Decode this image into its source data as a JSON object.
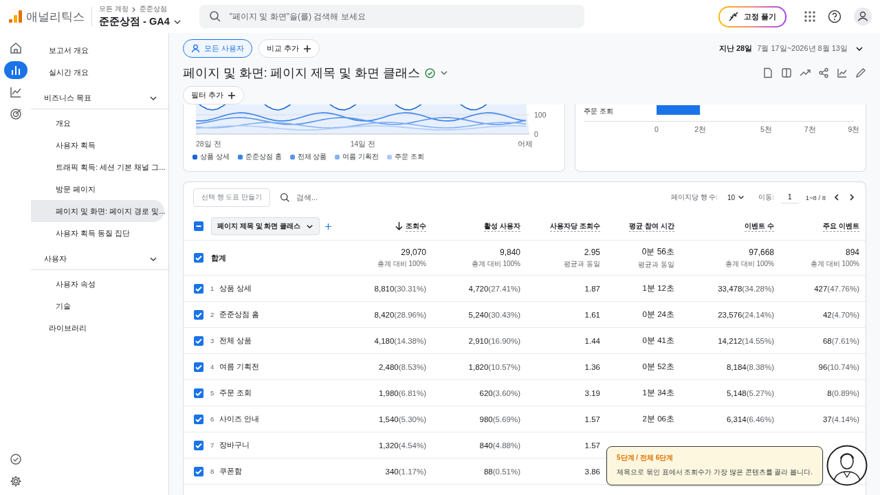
{
  "header": {
    "product": "애널리틱스",
    "breadcrumb": [
      "모든 계정",
      "준준상점"
    ],
    "property": "준준상점 - GA4",
    "search_placeholder": "\"페이지 및 화면\"을(를) 검색해 보세요",
    "unpin_button": "고정 풀기"
  },
  "rail": [
    {
      "kind": "home",
      "selected": false
    },
    {
      "kind": "bar-chart",
      "selected": true
    },
    {
      "kind": "line-chart",
      "selected": false
    },
    {
      "kind": "target",
      "selected": false
    }
  ],
  "rail_bottom": [
    {
      "kind": "check-circle"
    },
    {
      "kind": "gear"
    }
  ],
  "nav": [
    {
      "kind": "item",
      "label": "보고서 개요",
      "selected": false
    },
    {
      "kind": "item",
      "label": "실시간 개요",
      "selected": false
    },
    {
      "kind": "section",
      "label": "비즈니스 목표",
      "expanded": true,
      "children": [
        {
          "label": "개요",
          "selected": false
        },
        {
          "label": "사용자 획득",
          "selected": false
        },
        {
          "label": "트래픽 획득: 세션 기본 채널 그...",
          "selected": false
        },
        {
          "label": "방문 페이지",
          "selected": false
        },
        {
          "label": "페이지 및 화면: 페이지 경로 및...",
          "selected": true
        },
        {
          "label": "사용자 획득 동질 집단",
          "selected": false
        }
      ]
    },
    {
      "kind": "section",
      "label": "사용자",
      "expanded": true,
      "children": [
        {
          "label": "사용자 속성",
          "selected": false
        },
        {
          "label": "기술",
          "selected": false
        }
      ]
    },
    {
      "kind": "item",
      "label": "라이브러리",
      "selected": false
    }
  ],
  "toolbar": {
    "segment": "모든 사용자",
    "compare": "비교 추가",
    "date_label": "지난 28일",
    "date_range": "7월 17일~2026년 8월 13일"
  },
  "report": {
    "title": "페이지 및 화면: 페이지 제목 및 화면 클래스",
    "verified": true,
    "filter_button": "필터 추가"
  },
  "line_chart": {
    "y_tick_labels": [
      "100",
      "0"
    ],
    "x_tick_labels": [
      "28일 전",
      "14일 전",
      "어제"
    ],
    "legend": [
      {
        "name": "상품 상세",
        "color": "#1967d2"
      },
      {
        "name": "준준상점 홈",
        "color": "#3b82e8"
      },
      {
        "name": "전체 상품",
        "color": "#5a95ea"
      },
      {
        "name": "여름 기획전",
        "color": "#86b2f1"
      },
      {
        "name": "주문 조회",
        "color": "#aecbfa"
      }
    ]
  },
  "bar_chart": {
    "chart_data": {
      "type": "bar",
      "orientation": "horizontal",
      "categories": [
        "주문 조회"
      ],
      "series": [
        {
          "color": "#1a73e8",
          "values": [
            1.98
          ]
        }
      ],
      "xlim": [
        0,
        9
      ],
      "xticks": [
        {
          "value": 0,
          "label": "0"
        },
        {
          "value": 2,
          "label": "2천"
        },
        {
          "value": 5,
          "label": "5천"
        },
        {
          "value": 7,
          "label": "7천"
        },
        {
          "value": 9,
          "label": "9천"
        }
      ]
    }
  },
  "table": {
    "plot_button": "선택 행 도표 만들기",
    "search_placeholder": "검색...",
    "rows_per_page_label": "페이지당 행 수:",
    "rows_per_page": "10",
    "goto_label": "이동:",
    "goto_value": "1",
    "range": "1~8 / 8",
    "dimension": "페이지 제목 및 화면 클래스",
    "select_all_indeterminate": true,
    "columns": [
      {
        "label": "조회수",
        "sorted": true
      },
      {
        "label": "활성 사용자",
        "sorted": false
      },
      {
        "label": "사용자당 조회수",
        "sorted": false
      },
      {
        "label": "평균 참여 시간",
        "sorted": false
      },
      {
        "label": "이벤트 수",
        "sorted": false
      },
      {
        "label": "주요 이벤트",
        "sorted": false
      }
    ],
    "total": {
      "label": "합계",
      "checked": true,
      "cells": [
        {
          "value": "29,070",
          "note": "총계 대비 100%"
        },
        {
          "value": "9,840",
          "note": "총계 대비 100%"
        },
        {
          "value": "2.95",
          "note": "평균과 동일"
        },
        {
          "value": "0분 56초",
          "note": "평균과 동일"
        },
        {
          "value": "97,668",
          "note": "총계 대비 100%"
        },
        {
          "value": "894",
          "note": "총계 대비 100%"
        }
      ]
    },
    "rows": [
      {
        "index": "1",
        "name": "상품 상세",
        "checked": true,
        "cells": [
          {
            "value": "8,810",
            "share": "(30.31%)"
          },
          {
            "value": "4,720",
            "share": "(27.41%)"
          },
          {
            "value": "1.87"
          },
          {
            "value": "1분 12초"
          },
          {
            "value": "33,478",
            "share": "(34.28%)"
          },
          {
            "value": "427",
            "share": "(47.76%)"
          }
        ]
      },
      {
        "index": "2",
        "name": "준준상점 홈",
        "checked": true,
        "cells": [
          {
            "value": "8,420",
            "share": "(28.96%)"
          },
          {
            "value": "5,240",
            "share": "(30.43%)"
          },
          {
            "value": "1.61"
          },
          {
            "value": "0분 24초"
          },
          {
            "value": "23,576",
            "share": "(24.14%)"
          },
          {
            "value": "42",
            "share": "(4.70%)"
          }
        ]
      },
      {
        "index": "3",
        "name": "전체 상품",
        "checked": true,
        "cells": [
          {
            "value": "4,180",
            "share": "(14.38%)"
          },
          {
            "value": "2,910",
            "share": "(16.90%)"
          },
          {
            "value": "1.44"
          },
          {
            "value": "0분 41초"
          },
          {
            "value": "14,212",
            "share": "(14.55%)"
          },
          {
            "value": "68",
            "share": "(7.61%)"
          }
        ]
      },
      {
        "index": "4",
        "name": "여름 기획전",
        "checked": true,
        "cells": [
          {
            "value": "2,480",
            "share": "(8.53%)"
          },
          {
            "value": "1,820",
            "share": "(10.57%)"
          },
          {
            "value": "1.36"
          },
          {
            "value": "0분 52초"
          },
          {
            "value": "8,184",
            "share": "(8.38%)"
          },
          {
            "value": "96",
            "share": "(10.74%)"
          }
        ]
      },
      {
        "index": "5",
        "name": "주문 조회",
        "checked": true,
        "cells": [
          {
            "value": "1,980",
            "share": "(6.81%)"
          },
          {
            "value": "620",
            "share": "(3.60%)"
          },
          {
            "value": "3.19"
          },
          {
            "value": "1분 34초"
          },
          {
            "value": "5,148",
            "share": "(5.27%)"
          },
          {
            "value": "8",
            "share": "(0.89%)"
          }
        ]
      },
      {
        "index": "6",
        "name": "사이즈 안내",
        "checked": true,
        "cells": [
          {
            "value": "1,540",
            "share": "(5.30%)"
          },
          {
            "value": "980",
            "share": "(5.69%)"
          },
          {
            "value": "1.57"
          },
          {
            "value": "2분 06초"
          },
          {
            "value": "6,314",
            "share": "(6.46%)"
          },
          {
            "value": "37",
            "share": "(4.14%)"
          }
        ]
      },
      {
        "index": "7",
        "name": "장바구니",
        "checked": true,
        "cells": [
          {
            "value": "1,320",
            "share": "(4.54%)"
          },
          {
            "value": "840",
            "share": "(4.88%)"
          },
          {
            "value": "1.57"
          }
        ]
      },
      {
        "index": "8",
        "name": "쿠폰함",
        "checked": true,
        "cells": [
          {
            "value": "340",
            "share": "(1.17%)"
          },
          {
            "value": "88",
            "share": "(0.51%)"
          },
          {
            "value": "3.86"
          }
        ]
      }
    ]
  },
  "tour": {
    "step": "5단계 / 전체 6단계",
    "message": "제목으로 묶인 표에서 조회수가 가장 많은 콘텐츠를 골라 봅니다."
  }
}
